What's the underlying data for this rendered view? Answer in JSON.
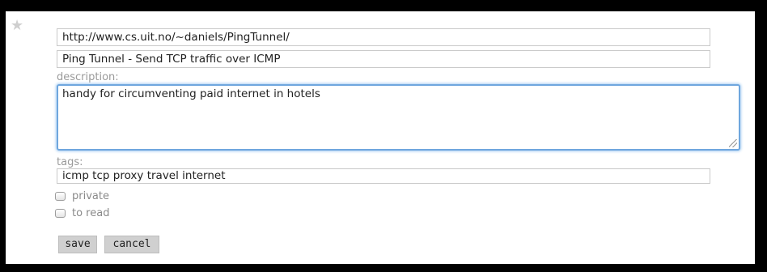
{
  "bookmark": {
    "star_icon": "star-icon",
    "url": "http://www.cs.uit.no/~daniels/PingTunnel/",
    "title": "Ping Tunnel - Send TCP traffic over ICMP",
    "description_label": "description:",
    "description": "handy for circumventing paid internet in hotels",
    "tags_label": "tags:",
    "tags": "icmp tcp proxy travel internet",
    "options": [
      {
        "label": "private",
        "checked": false
      },
      {
        "label": "to read",
        "checked": false
      }
    ],
    "buttons": {
      "save": "save",
      "cancel": "cancel"
    }
  },
  "colors": {
    "focus_border": "#6fa6de",
    "label_text": "#9a9a9a",
    "button_bg": "#d0d0d0"
  }
}
